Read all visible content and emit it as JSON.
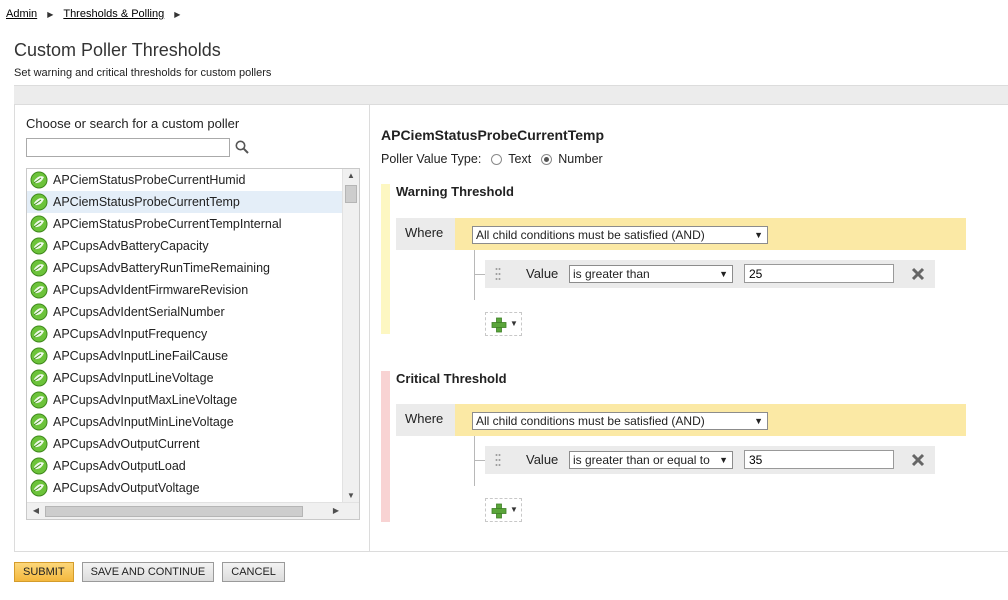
{
  "breadcrumb": [
    {
      "label": "Admin"
    },
    {
      "label": "Thresholds & Polling"
    }
  ],
  "page": {
    "title": "Custom Poller Thresholds",
    "subtitle": "Set warning and critical thresholds for custom pollers"
  },
  "left": {
    "choose_label": "Choose or search for a custom poller",
    "search_value": "",
    "items": [
      "APCiemStatusProbeCurrentHumid",
      "APCiemStatusProbeCurrentTemp",
      "APCiemStatusProbeCurrentTempInternal",
      "APCupsAdvBatteryCapacity",
      "APCupsAdvBatteryRunTimeRemaining",
      "APCupsAdvIdentFirmwareRevision",
      "APCupsAdvIdentSerialNumber",
      "APCupsAdvInputFrequency",
      "APCupsAdvInputLineFailCause",
      "APCupsAdvInputLineVoltage",
      "APCupsAdvInputMaxLineVoltage",
      "APCupsAdvInputMinLineVoltage",
      "APCupsAdvOutputCurrent",
      "APCupsAdvOutputLoad",
      "APCupsAdvOutputVoltage"
    ],
    "selected_index": 1,
    "icon": "poller-leaf-icon"
  },
  "right": {
    "poller_name": "APCiemStatusProbeCurrentTemp",
    "value_type_label": "Poller Value Type:",
    "value_type_options": [
      "Text",
      "Number"
    ],
    "value_type_selected": "Number",
    "warning": {
      "title": "Warning Threshold",
      "where_label": "Where",
      "condition_mode": "All child conditions must be satisfied (AND)",
      "condition": {
        "field": "Value",
        "operator": "is greater than",
        "value": "25"
      }
    },
    "critical": {
      "title": "Critical Threshold",
      "where_label": "Where",
      "condition_mode": "All child conditions must be satisfied (AND)",
      "condition": {
        "field": "Value",
        "operator": "is greater than or equal to",
        "value": "35"
      }
    }
  },
  "actions": {
    "submit": "Submit",
    "save_continue": "Save and Continue",
    "cancel": "Cancel"
  },
  "colors": {
    "warning_stripe": "#fdf7c2",
    "critical_stripe": "#f8d3d3",
    "and_bar": "#fbe9a5",
    "selected_row": "#e4eef8",
    "primary_button": "#f4b83e"
  }
}
